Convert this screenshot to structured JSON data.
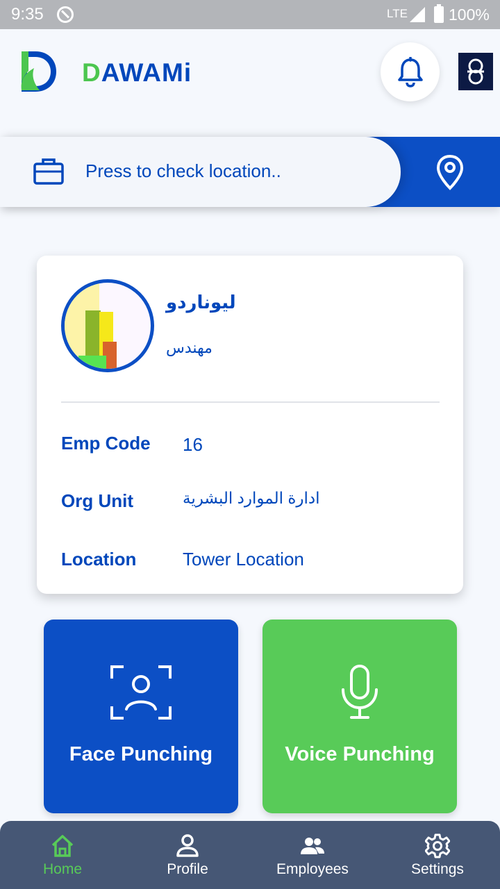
{
  "status_bar": {
    "time": "9:35",
    "network": "LTE",
    "battery": "100%"
  },
  "header": {
    "brand_first_letter": "D",
    "brand_rest": "AWAMi",
    "bell_icon": "bell-icon",
    "company_logo": "company-logo"
  },
  "location_bar": {
    "text": "Press to check location..",
    "left_icon": "briefcase-icon",
    "right_icon": "map-pin-icon"
  },
  "profile": {
    "name": "ليوناردو",
    "title": "مهندس",
    "fields": [
      {
        "label": "Emp Code",
        "value": "16"
      },
      {
        "label": "Org Unit",
        "value": "ادارة الموارد البشرية"
      },
      {
        "label": "Location",
        "value": "Tower Location"
      }
    ]
  },
  "actions": [
    {
      "label": "Face Punching",
      "icon": "face-scan-icon",
      "color": "#0c4fc5"
    },
    {
      "label": "Voice Punching",
      "icon": "microphone-icon",
      "color": "#58cb58"
    }
  ],
  "nav": {
    "items": [
      {
        "label": "Home",
        "icon": "home-icon",
        "active": true
      },
      {
        "label": "Profile",
        "icon": "person-icon",
        "active": false
      },
      {
        "label": "Employees",
        "icon": "people-icon",
        "active": false
      },
      {
        "label": "Settings",
        "icon": "gear-icon",
        "active": false
      }
    ]
  },
  "colors": {
    "primary": "#0047bb",
    "accent_green": "#58cb58",
    "nav_bg": "#465775"
  }
}
